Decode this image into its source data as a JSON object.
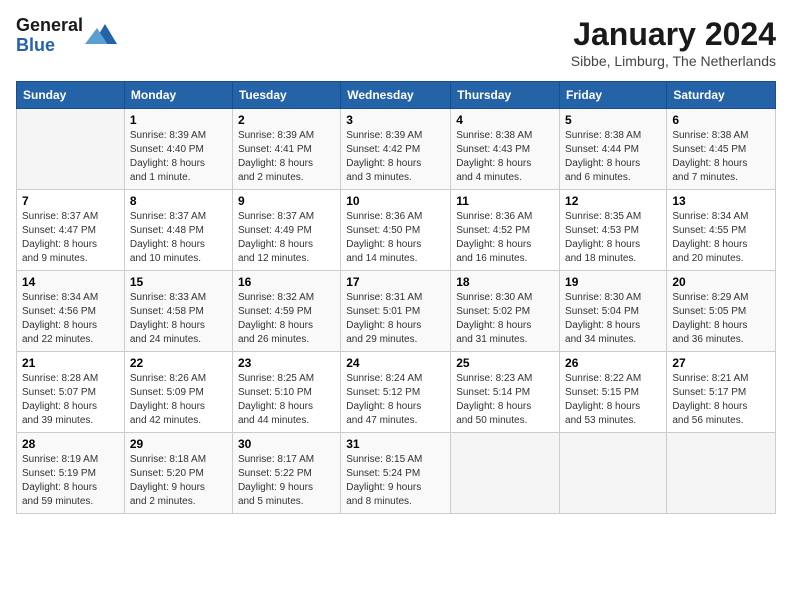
{
  "header": {
    "logo_general": "General",
    "logo_blue": "Blue",
    "month_title": "January 2024",
    "location": "Sibbe, Limburg, The Netherlands"
  },
  "calendar": {
    "days_of_week": [
      "Sunday",
      "Monday",
      "Tuesday",
      "Wednesday",
      "Thursday",
      "Friday",
      "Saturday"
    ],
    "weeks": [
      [
        {
          "day": "",
          "info": ""
        },
        {
          "day": "1",
          "info": "Sunrise: 8:39 AM\nSunset: 4:40 PM\nDaylight: 8 hours\nand 1 minute."
        },
        {
          "day": "2",
          "info": "Sunrise: 8:39 AM\nSunset: 4:41 PM\nDaylight: 8 hours\nand 2 minutes."
        },
        {
          "day": "3",
          "info": "Sunrise: 8:39 AM\nSunset: 4:42 PM\nDaylight: 8 hours\nand 3 minutes."
        },
        {
          "day": "4",
          "info": "Sunrise: 8:38 AM\nSunset: 4:43 PM\nDaylight: 8 hours\nand 4 minutes."
        },
        {
          "day": "5",
          "info": "Sunrise: 8:38 AM\nSunset: 4:44 PM\nDaylight: 8 hours\nand 6 minutes."
        },
        {
          "day": "6",
          "info": "Sunrise: 8:38 AM\nSunset: 4:45 PM\nDaylight: 8 hours\nand 7 minutes."
        }
      ],
      [
        {
          "day": "7",
          "info": "Sunrise: 8:37 AM\nSunset: 4:47 PM\nDaylight: 8 hours\nand 9 minutes."
        },
        {
          "day": "8",
          "info": "Sunrise: 8:37 AM\nSunset: 4:48 PM\nDaylight: 8 hours\nand 10 minutes."
        },
        {
          "day": "9",
          "info": "Sunrise: 8:37 AM\nSunset: 4:49 PM\nDaylight: 8 hours\nand 12 minutes."
        },
        {
          "day": "10",
          "info": "Sunrise: 8:36 AM\nSunset: 4:50 PM\nDaylight: 8 hours\nand 14 minutes."
        },
        {
          "day": "11",
          "info": "Sunrise: 8:36 AM\nSunset: 4:52 PM\nDaylight: 8 hours\nand 16 minutes."
        },
        {
          "day": "12",
          "info": "Sunrise: 8:35 AM\nSunset: 4:53 PM\nDaylight: 8 hours\nand 18 minutes."
        },
        {
          "day": "13",
          "info": "Sunrise: 8:34 AM\nSunset: 4:55 PM\nDaylight: 8 hours\nand 20 minutes."
        }
      ],
      [
        {
          "day": "14",
          "info": "Sunrise: 8:34 AM\nSunset: 4:56 PM\nDaylight: 8 hours\nand 22 minutes."
        },
        {
          "day": "15",
          "info": "Sunrise: 8:33 AM\nSunset: 4:58 PM\nDaylight: 8 hours\nand 24 minutes."
        },
        {
          "day": "16",
          "info": "Sunrise: 8:32 AM\nSunset: 4:59 PM\nDaylight: 8 hours\nand 26 minutes."
        },
        {
          "day": "17",
          "info": "Sunrise: 8:31 AM\nSunset: 5:01 PM\nDaylight: 8 hours\nand 29 minutes."
        },
        {
          "day": "18",
          "info": "Sunrise: 8:30 AM\nSunset: 5:02 PM\nDaylight: 8 hours\nand 31 minutes."
        },
        {
          "day": "19",
          "info": "Sunrise: 8:30 AM\nSunset: 5:04 PM\nDaylight: 8 hours\nand 34 minutes."
        },
        {
          "day": "20",
          "info": "Sunrise: 8:29 AM\nSunset: 5:05 PM\nDaylight: 8 hours\nand 36 minutes."
        }
      ],
      [
        {
          "day": "21",
          "info": "Sunrise: 8:28 AM\nSunset: 5:07 PM\nDaylight: 8 hours\nand 39 minutes."
        },
        {
          "day": "22",
          "info": "Sunrise: 8:26 AM\nSunset: 5:09 PM\nDaylight: 8 hours\nand 42 minutes."
        },
        {
          "day": "23",
          "info": "Sunrise: 8:25 AM\nSunset: 5:10 PM\nDaylight: 8 hours\nand 44 minutes."
        },
        {
          "day": "24",
          "info": "Sunrise: 8:24 AM\nSunset: 5:12 PM\nDaylight: 8 hours\nand 47 minutes."
        },
        {
          "day": "25",
          "info": "Sunrise: 8:23 AM\nSunset: 5:14 PM\nDaylight: 8 hours\nand 50 minutes."
        },
        {
          "day": "26",
          "info": "Sunrise: 8:22 AM\nSunset: 5:15 PM\nDaylight: 8 hours\nand 53 minutes."
        },
        {
          "day": "27",
          "info": "Sunrise: 8:21 AM\nSunset: 5:17 PM\nDaylight: 8 hours\nand 56 minutes."
        }
      ],
      [
        {
          "day": "28",
          "info": "Sunrise: 8:19 AM\nSunset: 5:19 PM\nDaylight: 8 hours\nand 59 minutes."
        },
        {
          "day": "29",
          "info": "Sunrise: 8:18 AM\nSunset: 5:20 PM\nDaylight: 9 hours\nand 2 minutes."
        },
        {
          "day": "30",
          "info": "Sunrise: 8:17 AM\nSunset: 5:22 PM\nDaylight: 9 hours\nand 5 minutes."
        },
        {
          "day": "31",
          "info": "Sunrise: 8:15 AM\nSunset: 5:24 PM\nDaylight: 9 hours\nand 8 minutes."
        },
        {
          "day": "",
          "info": ""
        },
        {
          "day": "",
          "info": ""
        },
        {
          "day": "",
          "info": ""
        }
      ]
    ]
  }
}
